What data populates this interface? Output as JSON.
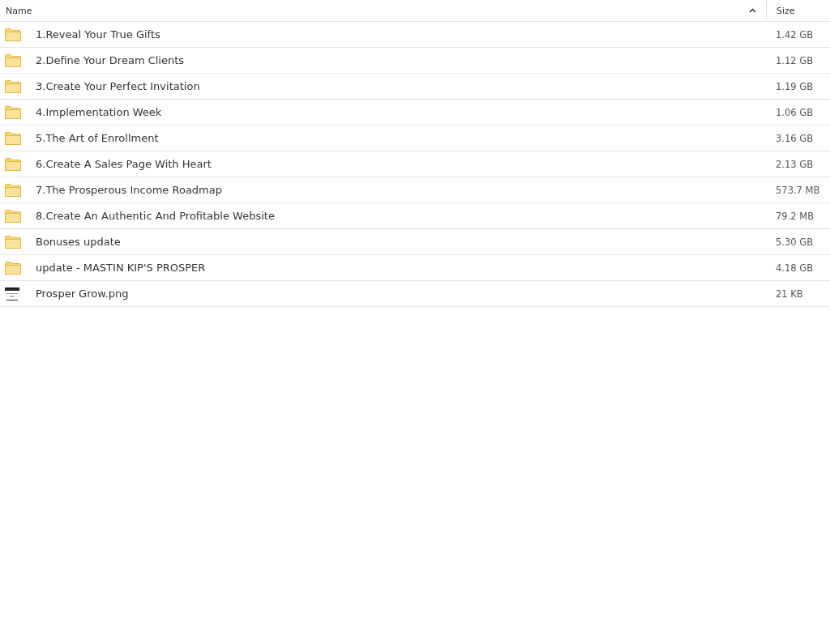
{
  "columns": [
    {
      "label": "Name",
      "sorted": true
    },
    {
      "label": "Size",
      "sorted": false
    }
  ],
  "rows": [
    {
      "kind": "folder",
      "name": "1.Reveal Your True Gifts",
      "size": "1.42 GB"
    },
    {
      "kind": "folder",
      "name": "2.Define Your Dream Clients",
      "size": "1.12 GB"
    },
    {
      "kind": "folder",
      "name": "3.Create Your Perfect Invitation",
      "size": "1.19 GB"
    },
    {
      "kind": "folder",
      "name": "4.Implementation Week",
      "size": "1.06 GB"
    },
    {
      "kind": "folder",
      "name": "5.The Art of Enrollment",
      "size": "3.16 GB"
    },
    {
      "kind": "folder",
      "name": "6.Create A Sales Page With Heart",
      "size": "2.13 GB"
    },
    {
      "kind": "folder",
      "name": "7.The Prosperous Income Roadmap",
      "size": "573.7 MB"
    },
    {
      "kind": "folder",
      "name": "8.Create An Authentic And Profitable Website",
      "size": "79.2 MB"
    },
    {
      "kind": "folder",
      "name": "Bonuses update",
      "size": "5.30 GB"
    },
    {
      "kind": "folder",
      "name": "update - MASTIN KIP'S PROSPER",
      "size": "4.18 GB"
    },
    {
      "kind": "image",
      "name": "Prosper Grow.png",
      "size": "21 KB"
    }
  ]
}
